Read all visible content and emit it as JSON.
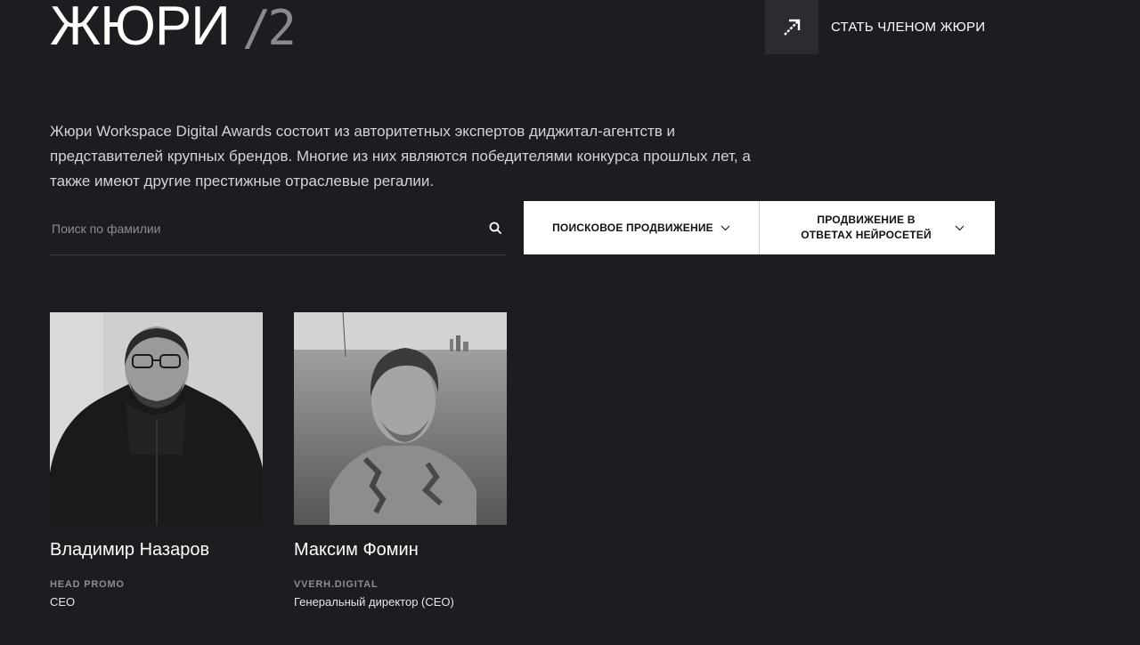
{
  "header": {
    "title": "ЖЮРИ",
    "counter": "/2",
    "become_juror_label": "СТАТЬ ЧЛЕНОМ ЖЮРИ",
    "become_juror_icon": "arrow-up-right-icon"
  },
  "intro": {
    "text": "Жюри Workspace Digital Awards состоит из авторитетных экспертов диджитал-агентств и представителей крупных брендов. Многие из них являются победителями конкурса прошлых лет, а также имеют другие престижные отраслевые регалии."
  },
  "search": {
    "placeholder": "Поиск по фамилии",
    "value": "",
    "icon": "search-icon"
  },
  "filters": [
    {
      "label": "ПОИСКОВОЕ ПРОДВИЖЕНИЕ",
      "icon": "chevron-down-icon"
    },
    {
      "label": "ПРОДВИЖЕНИЕ В ОТВЕТАХ НЕЙРОСЕТЕЙ",
      "icon": "chevron-down-icon"
    }
  ],
  "jury": [
    {
      "name": "Владимир Назаров",
      "company": "HEAD PROMO",
      "role": "CEO"
    },
    {
      "name": "Максим Фомин",
      "company": "VVERH.DIGITAL",
      "role": "Генеральный директор (CEO)"
    }
  ],
  "colors": {
    "background": "#1d1c20",
    "text": "#ffffff",
    "muted": "#8d8c91",
    "filter_bg": "#ffffff",
    "icon_box": "#2c2b30"
  }
}
